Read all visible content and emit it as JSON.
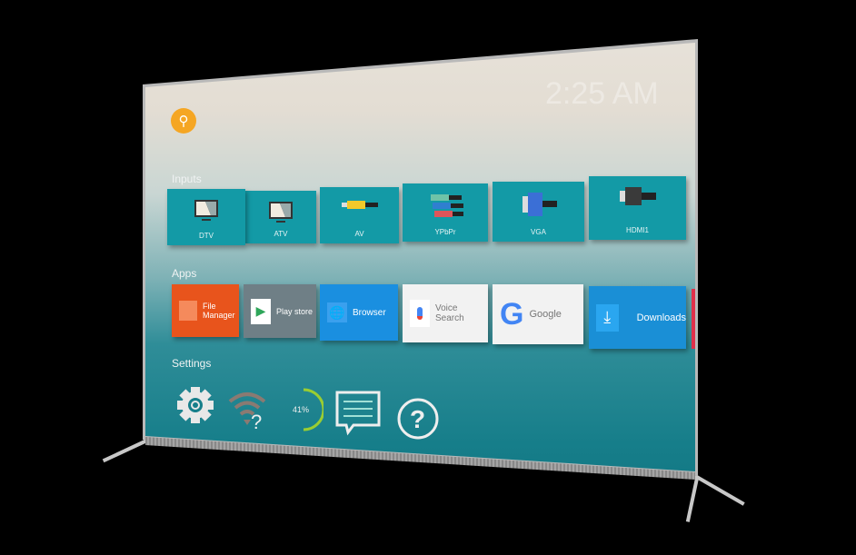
{
  "clock": "2:25 AM",
  "search": {
    "icon": "search-icon",
    "color": "#f5a623"
  },
  "inputs": {
    "title": "Inputs",
    "items": [
      {
        "label": "DTV",
        "icon": "tv-icon"
      },
      {
        "label": "ATV",
        "icon": "tv-icon"
      },
      {
        "label": "AV",
        "icon": "av-cable-icon"
      },
      {
        "label": "YPbPr",
        "icon": "component-cable-icon"
      },
      {
        "label": "VGA",
        "icon": "vga-cable-icon"
      },
      {
        "label": "HDMI1",
        "icon": "hdmi-cable-icon"
      }
    ]
  },
  "apps": {
    "title": "Apps",
    "items": [
      {
        "label": "File Manager",
        "icon": "folder-icon",
        "color": "#e8541c"
      },
      {
        "label": "Play store",
        "icon": "play-store-icon",
        "color": "#6f7f86"
      },
      {
        "label": "Browser",
        "icon": "globe-icon",
        "color": "#1a8fe0"
      },
      {
        "label": "Voice Search",
        "icon": "microphone-icon",
        "color": "#f2f2f2"
      },
      {
        "label": "Google",
        "icon": "google-icon",
        "color": "#f2f2f2"
      },
      {
        "label": "Downloads",
        "icon": "download-icon",
        "color": "#1a8fd6"
      }
    ]
  },
  "settings": {
    "title": "Settings",
    "storage_percent": "41%",
    "storage_value": 41,
    "items": [
      "gear-icon",
      "wifi-unknown-icon",
      "storage-gauge",
      "message-icon",
      "help-icon"
    ]
  }
}
